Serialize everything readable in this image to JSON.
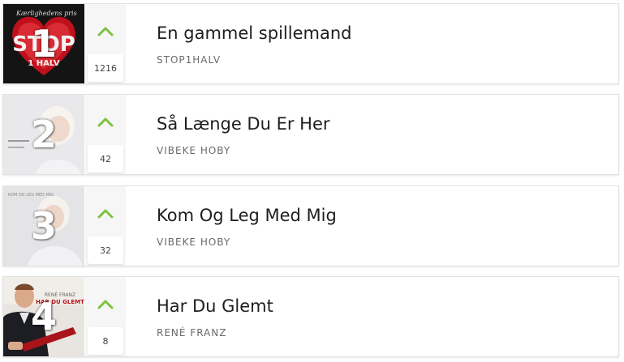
{
  "colors": {
    "arrow_up": "#7dc242",
    "title": "#1e1e1e",
    "artist": "#6a6a6a",
    "card_border": "#e2e2e2",
    "trend_bg": "#f6f6f6"
  },
  "chart": {
    "rows": [
      {
        "rank": "1",
        "title": "En gammel spillemand",
        "artist": "STOP1HALV",
        "count": "1216",
        "trend": "up",
        "trend_icon": "chevron-up-icon",
        "cover_text_top": "Kærlighedens pris",
        "cover_text_main": "STOP",
        "cover_text_sub": "1 HALV"
      },
      {
        "rank": "2",
        "title": "Så Længe Du Er Her",
        "artist": "VIBEKE HOBY",
        "count": "42",
        "trend": "up",
        "trend_icon": "chevron-up-icon"
      },
      {
        "rank": "3",
        "title": "Kom Og Leg Med Mig",
        "artist": "VIBEKE HOBY",
        "count": "32",
        "trend": "up",
        "trend_icon": "chevron-up-icon",
        "cover_text_top": "KOM OG LEG MED MIG"
      },
      {
        "rank": "4",
        "title": "Har Du Glemt",
        "artist": "RENÉ FRANZ",
        "count": "8",
        "trend": "up",
        "trend_icon": "chevron-up-icon",
        "cover_text_top": "RENÉ FRANZ",
        "cover_text_main": "HAR DU GLEMT"
      }
    ]
  }
}
